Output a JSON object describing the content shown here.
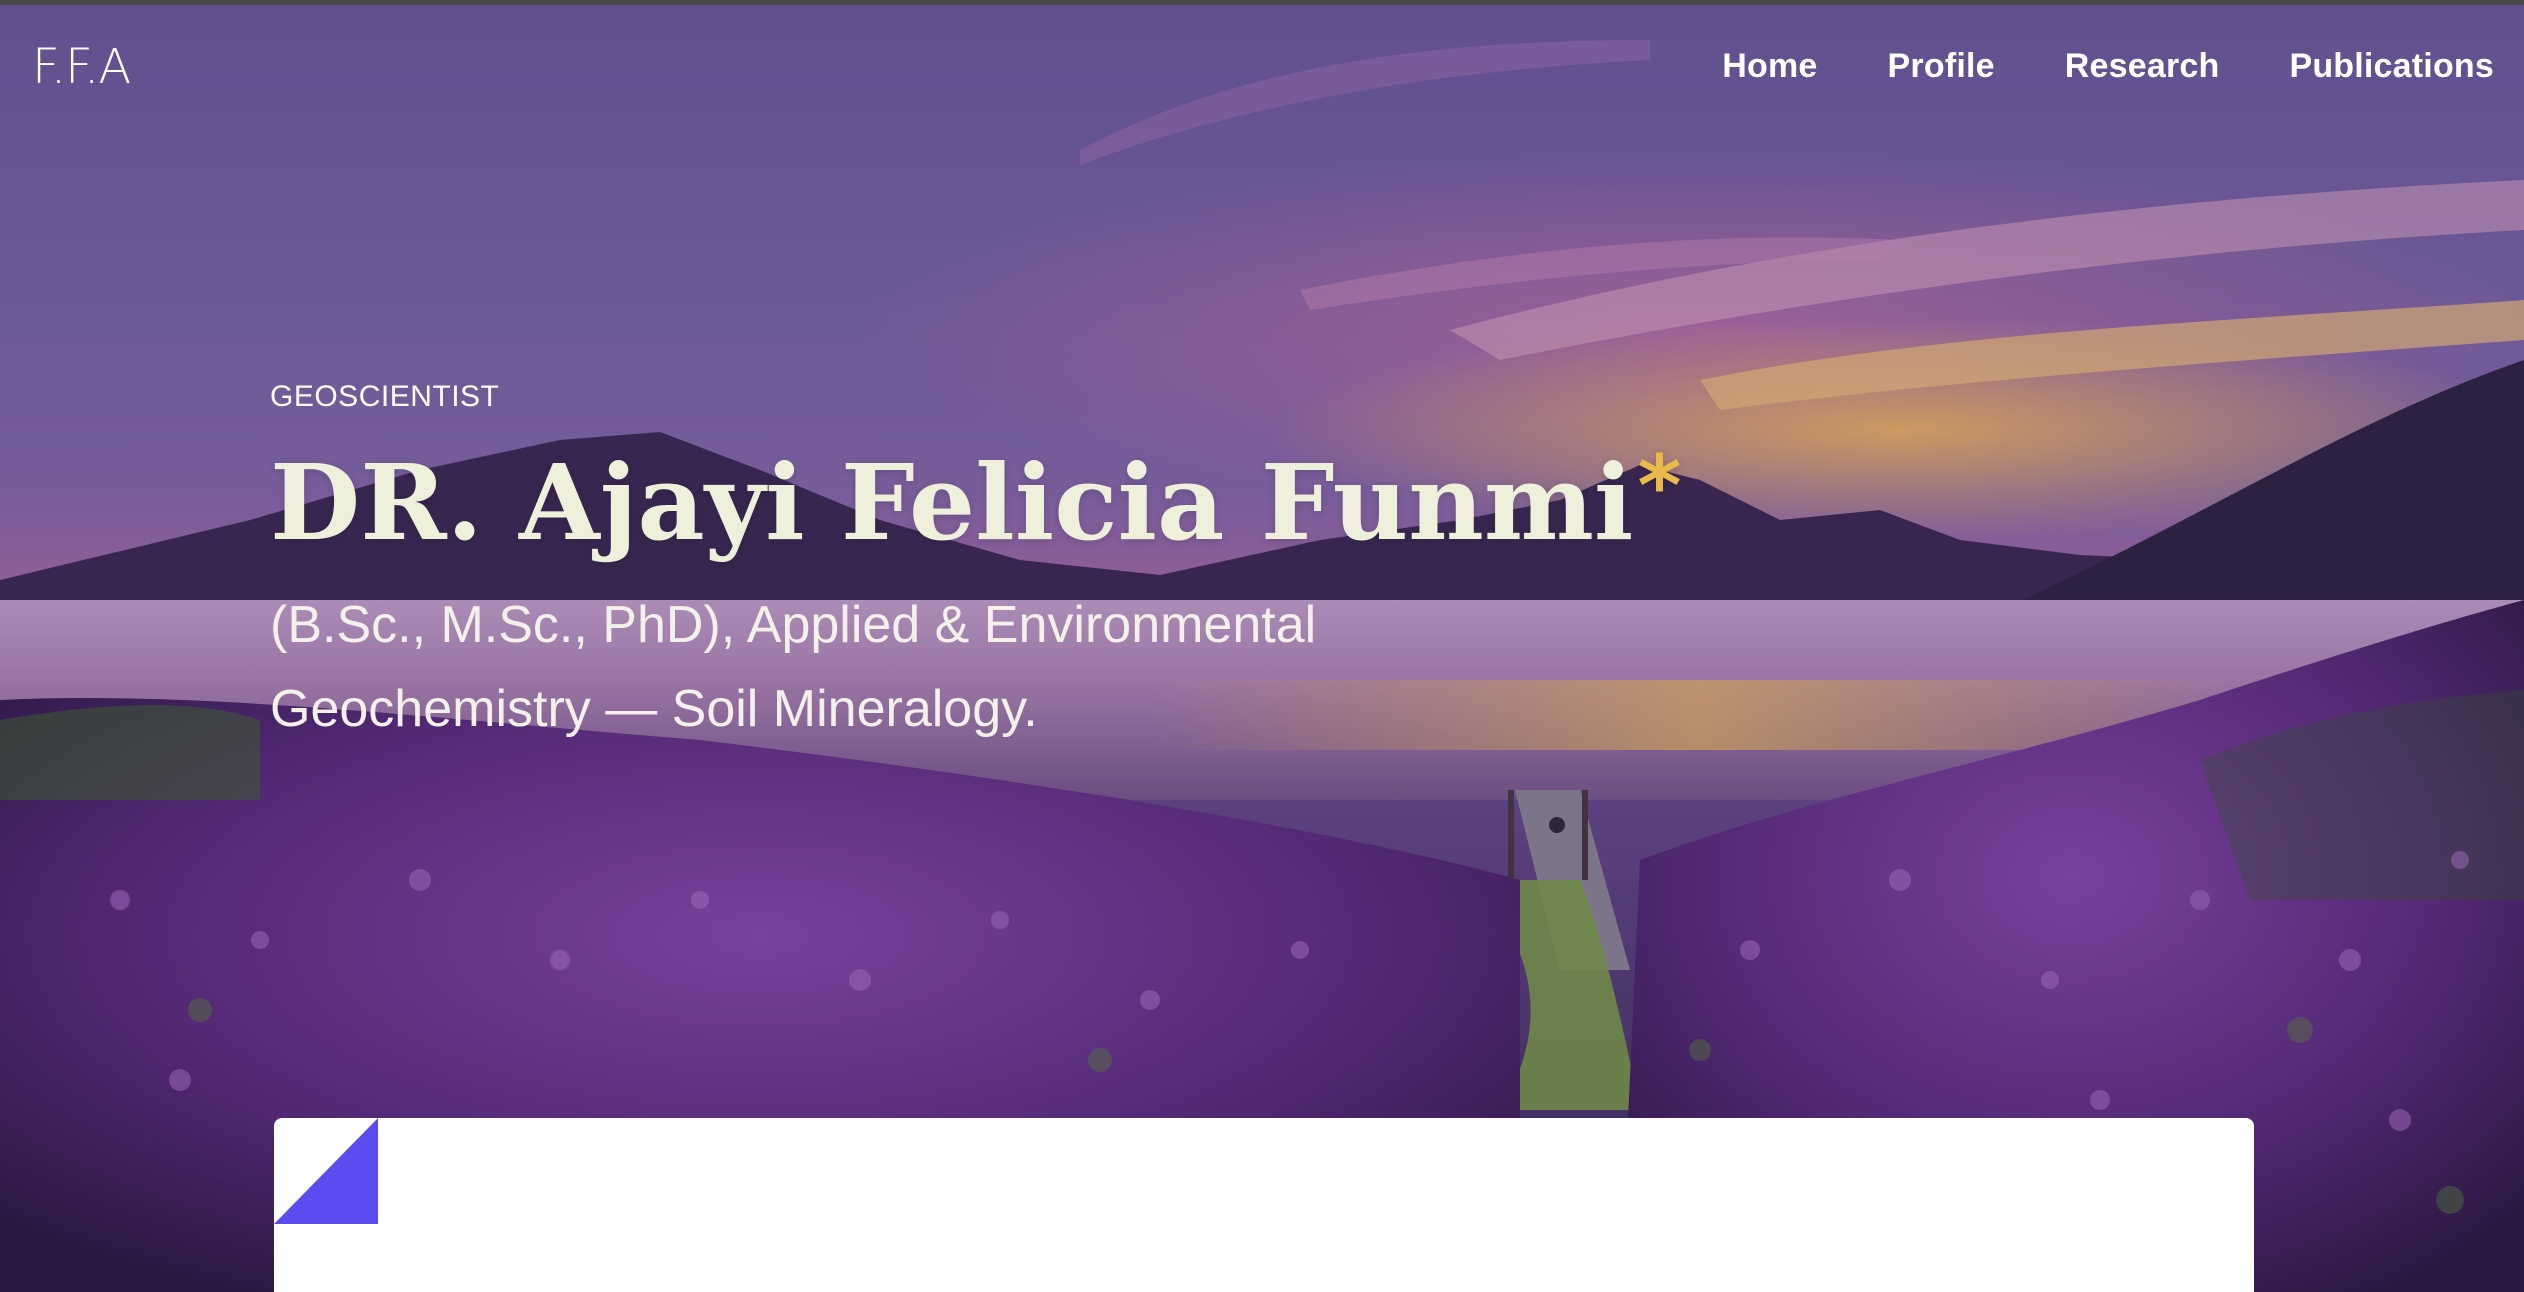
{
  "brand": {
    "logo_text": "F.F.A"
  },
  "nav": {
    "items": [
      {
        "label": "Home"
      },
      {
        "label": "Profile"
      },
      {
        "label": "Research"
      },
      {
        "label": "Publications"
      }
    ]
  },
  "hero": {
    "eyebrow": "GEOSCIENTIST",
    "name": "DR. Ajayi Felicia Funmi",
    "name_mark": "*",
    "subtitle": "(B.Sc., M.Sc., PhD), Applied & Environmental Geochemistry — Soil Mineralogy."
  },
  "colors": {
    "accent_gold": "#e9b94a",
    "accent_violet": "#5a4cf0",
    "title_text": "#eef0dc",
    "card_bg": "#ffffff"
  },
  "icons": {
    "card_corner": "folded-corner-icon"
  }
}
